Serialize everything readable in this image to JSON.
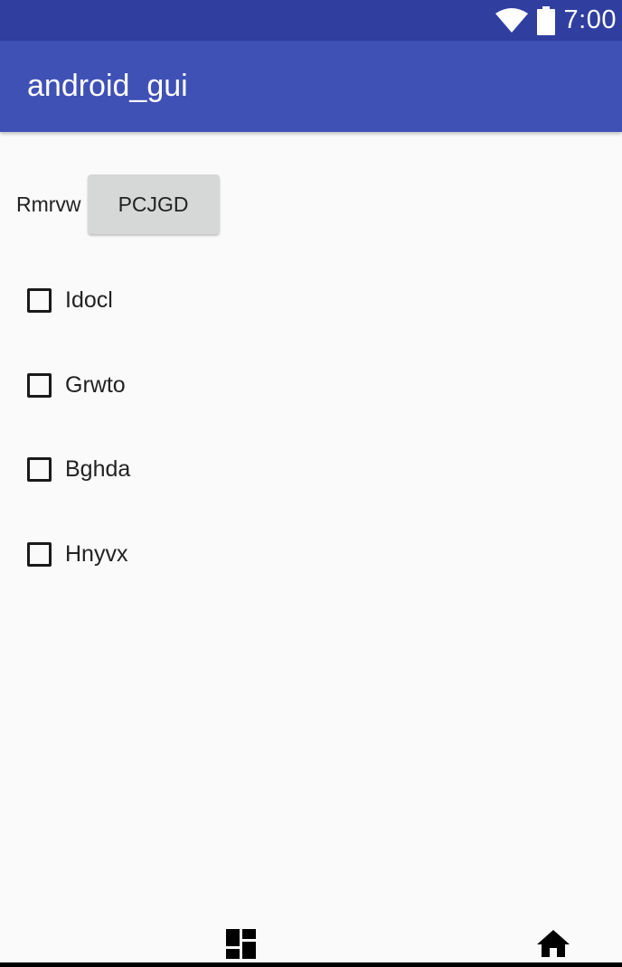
{
  "status_bar": {
    "time": "7:00",
    "wifi_icon": "wifi-icon",
    "battery_icon": "battery-icon",
    "color": "#303f9f"
  },
  "app_bar": {
    "title": "android_gui",
    "color": "#3f51b5"
  },
  "main": {
    "label": "Rmrvw",
    "button_label": "PCJGD",
    "checkboxes": [
      {
        "label": "Idocl",
        "checked": false
      },
      {
        "label": "Grwto",
        "checked": false
      },
      {
        "label": "Bghda",
        "checked": false
      },
      {
        "label": "Hnyvx",
        "checked": false
      }
    ]
  },
  "bottom_nav": {
    "items": [
      {
        "icon": "dashboard-icon"
      },
      {
        "icon": "home-icon"
      }
    ]
  }
}
